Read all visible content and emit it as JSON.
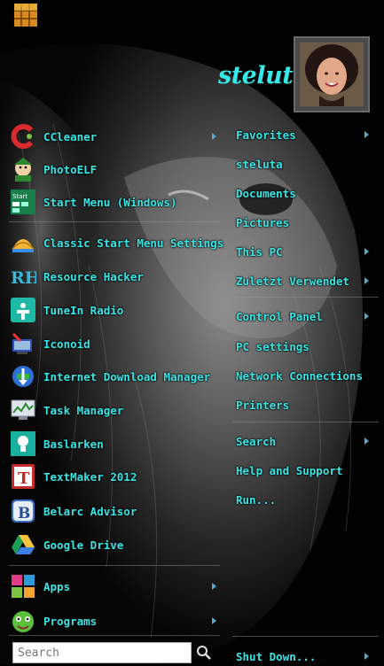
{
  "user": {
    "name": "steluta"
  },
  "programs": [
    {
      "label": "CCleaner",
      "icon": "ccleaner-icon",
      "arrow": true
    },
    {
      "label": "PhotoELF",
      "icon": "photoelf-icon",
      "arrow": false
    },
    {
      "label": "Start Menu (Windows)",
      "icon": "start-menu-icon",
      "arrow": false
    },
    {
      "label": "Classic Start Menu Settings",
      "icon": "classic-shell-icon",
      "arrow": false
    },
    {
      "label": "Resource Hacker",
      "icon": "resource-hacker-icon",
      "arrow": false
    },
    {
      "label": "TuneIn Radio",
      "icon": "tunein-radio-icon",
      "arrow": false
    },
    {
      "label": "Iconoid",
      "icon": "iconoid-icon",
      "arrow": false
    },
    {
      "label": "Internet Download Manager",
      "icon": "idm-icon",
      "arrow": false
    },
    {
      "label": "Task Manager",
      "icon": "task-manager-icon",
      "arrow": false
    },
    {
      "label": "Baslarken",
      "icon": "baslarken-icon",
      "arrow": false
    },
    {
      "label": "TextMaker 2012",
      "icon": "textmaker-icon",
      "arrow": false
    },
    {
      "label": "Belarc Advisor",
      "icon": "belarc-icon",
      "arrow": false
    },
    {
      "label": "Google Drive",
      "icon": "google-drive-icon",
      "arrow": false
    }
  ],
  "bottom_programs": [
    {
      "label": "Apps",
      "icon": "apps-icon",
      "arrow": true
    },
    {
      "label": "Programs",
      "icon": "programs-icon",
      "arrow": true
    }
  ],
  "right_menu": [
    {
      "label": "Favorites",
      "arrow": true
    },
    {
      "label": "steluta",
      "arrow": false
    },
    {
      "label": "Documents",
      "arrow": false
    },
    {
      "label": "Pictures",
      "arrow": false
    },
    {
      "label": "This PC",
      "arrow": true
    },
    {
      "label": "Zuletzt Verwendet",
      "arrow": true
    },
    {
      "label": "Control Panel",
      "arrow": true
    },
    {
      "label": "PC settings",
      "arrow": false
    },
    {
      "label": "Network Connections",
      "arrow": false
    },
    {
      "label": "Printers",
      "arrow": false
    },
    {
      "label": "Search",
      "arrow": true
    },
    {
      "label": "Help and Support",
      "arrow": false
    },
    {
      "label": "Run...",
      "arrow": false
    },
    {
      "label": "Shut Down...",
      "arrow": true
    }
  ],
  "search": {
    "placeholder": "Search"
  }
}
